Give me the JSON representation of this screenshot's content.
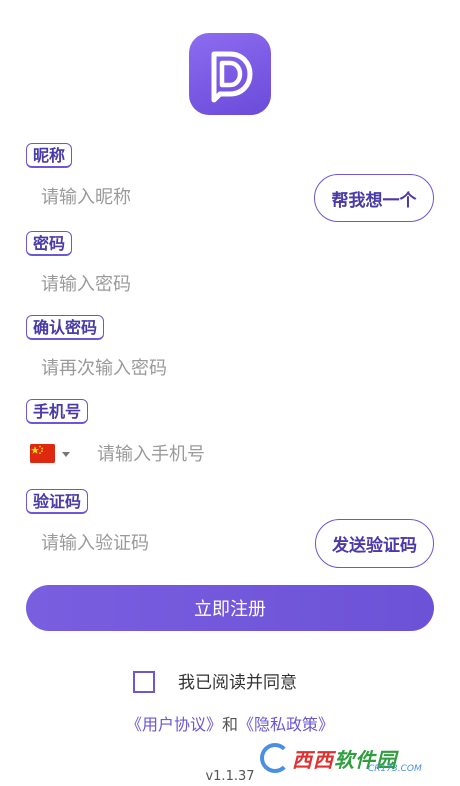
{
  "logo": {
    "icon": "app-logo-d-speech-icon",
    "color": "#7457e0"
  },
  "nickname": {
    "label": "昵称",
    "placeholder": "请输入昵称",
    "suggest_button": "帮我想一个"
  },
  "password": {
    "label": "密码",
    "placeholder": "请输入密码"
  },
  "confirm_password": {
    "label": "确认密码",
    "placeholder": "请再次输入密码"
  },
  "phone": {
    "label": "手机号",
    "country_flag": "china-flag-icon",
    "placeholder": "请输入手机号"
  },
  "verification": {
    "label": "验证码",
    "placeholder": "请输入验证码",
    "send_button": "发送验证码"
  },
  "register_button": "立即注册",
  "agreement": {
    "checked": false,
    "text": "我已阅读并同意",
    "user_agreement": "《用户协议》",
    "and": "和",
    "privacy_policy": "《隐私政策》"
  },
  "version": "v1.1.37",
  "watermark": {
    "text_red": "西西",
    "text_green": "软件园",
    "url": "CR173.COM"
  },
  "colors": {
    "accent": "#6c57d7",
    "button_gradient_start": "#7a5ee0",
    "button_gradient_end": "#6c52d6"
  }
}
